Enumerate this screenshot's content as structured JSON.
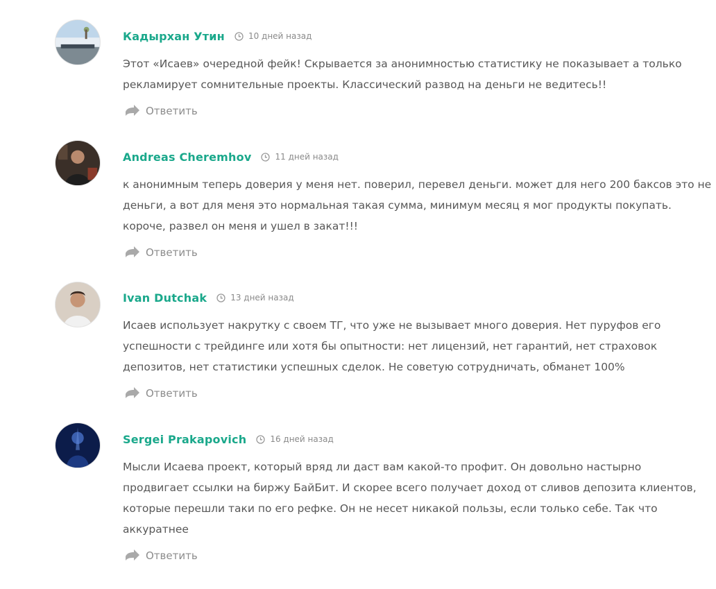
{
  "comments": [
    {
      "author": "Кадырхан Утин",
      "date": "10 дней назад",
      "lines": [
        "Этот «Исаев» очередной фейк! Скрывается за анонимностью статистику не показывает а только",
        "рекламирует сомнительные проекты. Классический развод на деньги не ведитесь!!"
      ],
      "reply_label": "Ответить"
    },
    {
      "author": "Andreas Cheremhov",
      "date": "11 дней назад",
      "lines": [
        "к анонимным теперь доверия у меня нет. поверил, перевел деньги. может для него 200 баксов это не",
        "деньги, а вот для меня это нормальная такая сумма, минимум месяц я мог продукты покупать.",
        "короче, развел он меня и ушел в закат!!!"
      ],
      "reply_label": "Ответить"
    },
    {
      "author": "Ivan Dutchak",
      "date": "13 дней назад",
      "lines": [
        "Исаев использует накрутку с своем ТГ, что уже не вызывает много доверия. Нет пуруфов его",
        "успешности с трейдинге или хотя бы опытности: нет лицензий, нет гарантий, нет страховок",
        "депозитов, нет статистики успешных сделок. Не советую сотрудничать, обманет 100%"
      ],
      "reply_label": "Ответить"
    },
    {
      "author": "Sergei Prakapovich",
      "date": "16 дней назад",
      "lines": [
        "Мысли Исаева проект, который вряд ли даст вам какой-то профит. Он довольно настырно",
        "продвигает ссылки на биржу БайБит. И скорее всего получает доход от сливов депозита клиентов,",
        "которые перешли таки по его рефке. Он не несет никакой пользы, если только себе. Так что",
        "аккуратнее"
      ],
      "reply_label": "Ответить"
    }
  ],
  "icons": {
    "clock": "clock-icon",
    "reply": "reply-arrow-icon"
  },
  "colors": {
    "author": "#1aa88b",
    "text": "#575757",
    "muted": "#8c8c8c"
  }
}
